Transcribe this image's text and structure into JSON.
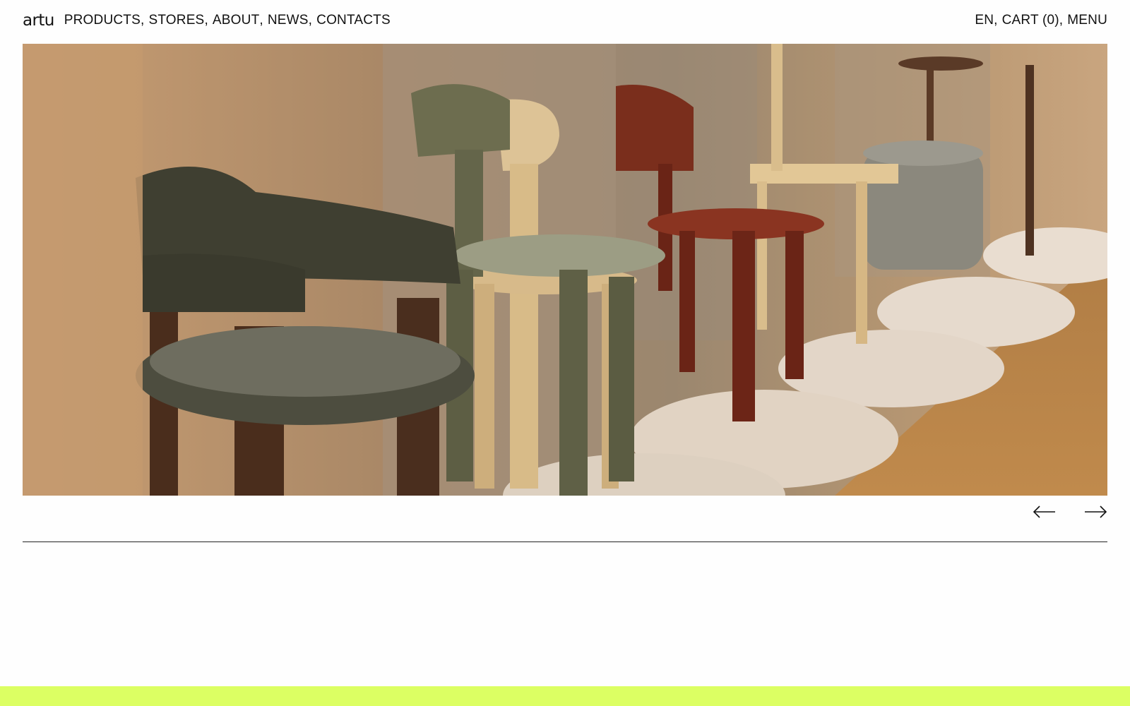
{
  "brand": {
    "logo": "artu"
  },
  "nav": {
    "items": [
      "PRODUCTS",
      "STORES",
      "ABOUT",
      "NEWS",
      "CONTACTS"
    ]
  },
  "header_right": {
    "language": "EN",
    "cart": "CART (0)",
    "menu": "MENU"
  },
  "hero": {
    "image": "photo of chairs and stools on round white platforms"
  },
  "carousel": {
    "prev_icon": "arrow-left-icon",
    "next_icon": "arrow-right-icon"
  },
  "colors": {
    "accent_band": "#dcff63",
    "text": "#111111",
    "background": "#fefefe"
  }
}
